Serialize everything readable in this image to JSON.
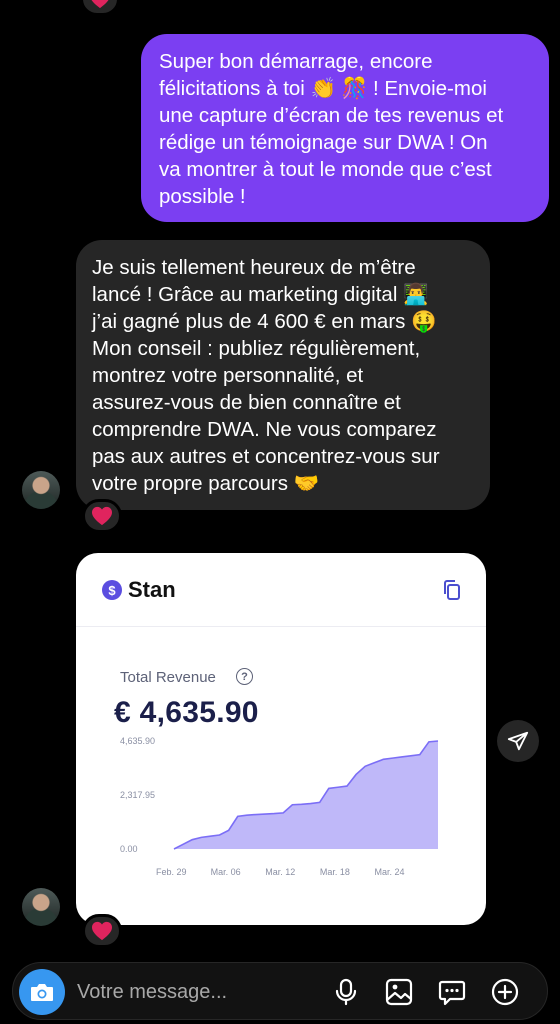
{
  "messages": {
    "outgoing": {
      "lines": [
        "Super bon démarrage, encore",
        "félicitations à toi 👏 🎊 ! Envoie-moi",
        "une capture d’écran de tes revenus et",
        "rédige un témoignage sur DWA ! On",
        "va montrer à tout le monde que c’est",
        "possible !"
      ]
    },
    "incoming": {
      "lines": [
        "Je suis tellement heureux de m’être",
        "lancé ! Grâce au marketing digital 👨‍💻",
        "j’ai gagné plus de 4 600 € en mars 🤑",
        "Mon conseil : publiez régulièrement,",
        "montrez votre personnalité, et",
        "assurez-vous de bien connaître et",
        "comprendre DWA. Ne vous comparez",
        "pas aux autres et concentrez-vous sur",
        "votre propre parcours 🤝"
      ]
    }
  },
  "card": {
    "brand": "Stan",
    "brand_logo_glyph": "$",
    "revenue_label": "Total Revenue",
    "help_glyph": "?",
    "revenue_value": "€ 4,635.90"
  },
  "chart_data": {
    "type": "area",
    "title": "",
    "xlabel": "",
    "ylabel": "",
    "y_ticks": [
      "4,635.90",
      "2,317.95",
      "0.00"
    ],
    "x_ticks": [
      "Feb. 29",
      "Mar. 06",
      "Mar. 12",
      "Mar. 18",
      "Mar. 24"
    ],
    "ylim": [
      0,
      4635.9
    ],
    "x": [
      "Feb. 29",
      "Mar. 01",
      "Mar. 02",
      "Mar. 03",
      "Mar. 04",
      "Mar. 05",
      "Mar. 06",
      "Mar. 07",
      "Mar. 08",
      "Mar. 09",
      "Mar. 10",
      "Mar. 11",
      "Mar. 12",
      "Mar. 13",
      "Mar. 14",
      "Mar. 15",
      "Mar. 16",
      "Mar. 17",
      "Mar. 18",
      "Mar. 19",
      "Mar. 20",
      "Mar. 21",
      "Mar. 22",
      "Mar. 23",
      "Mar. 24",
      "Mar. 25",
      "Mar. 26",
      "Mar. 27",
      "Mar. 28",
      "Mar. 29"
    ],
    "series": [
      {
        "values": [
          0,
          200,
          400,
          500,
          550,
          600,
          800,
          1400,
          1450,
          1480,
          1500,
          1520,
          1550,
          1900,
          1920,
          1950,
          2000,
          2600,
          2650,
          2700,
          3200,
          3550,
          3700,
          3850,
          3900,
          3950,
          4000,
          4050,
          4600,
          4635.9
        ]
      }
    ],
    "colors": {
      "line": "#7b6ef6",
      "fill": "#b4acf8"
    }
  },
  "composer": {
    "placeholder": "Votre message..."
  },
  "icons": {
    "reaction": "heart-icon",
    "copy": "copy-icon",
    "send": "paper-plane-icon",
    "camera": "camera-icon",
    "mic": "microphone-icon",
    "gallery": "image-icon",
    "sticker": "chat-bubble-icon",
    "add": "plus-circle-icon"
  },
  "colors": {
    "outgoing_bubble": "#7b3ff2",
    "incoming_bubble": "#262626",
    "camera_button": "#3797f0",
    "heart": "#e0245e"
  }
}
